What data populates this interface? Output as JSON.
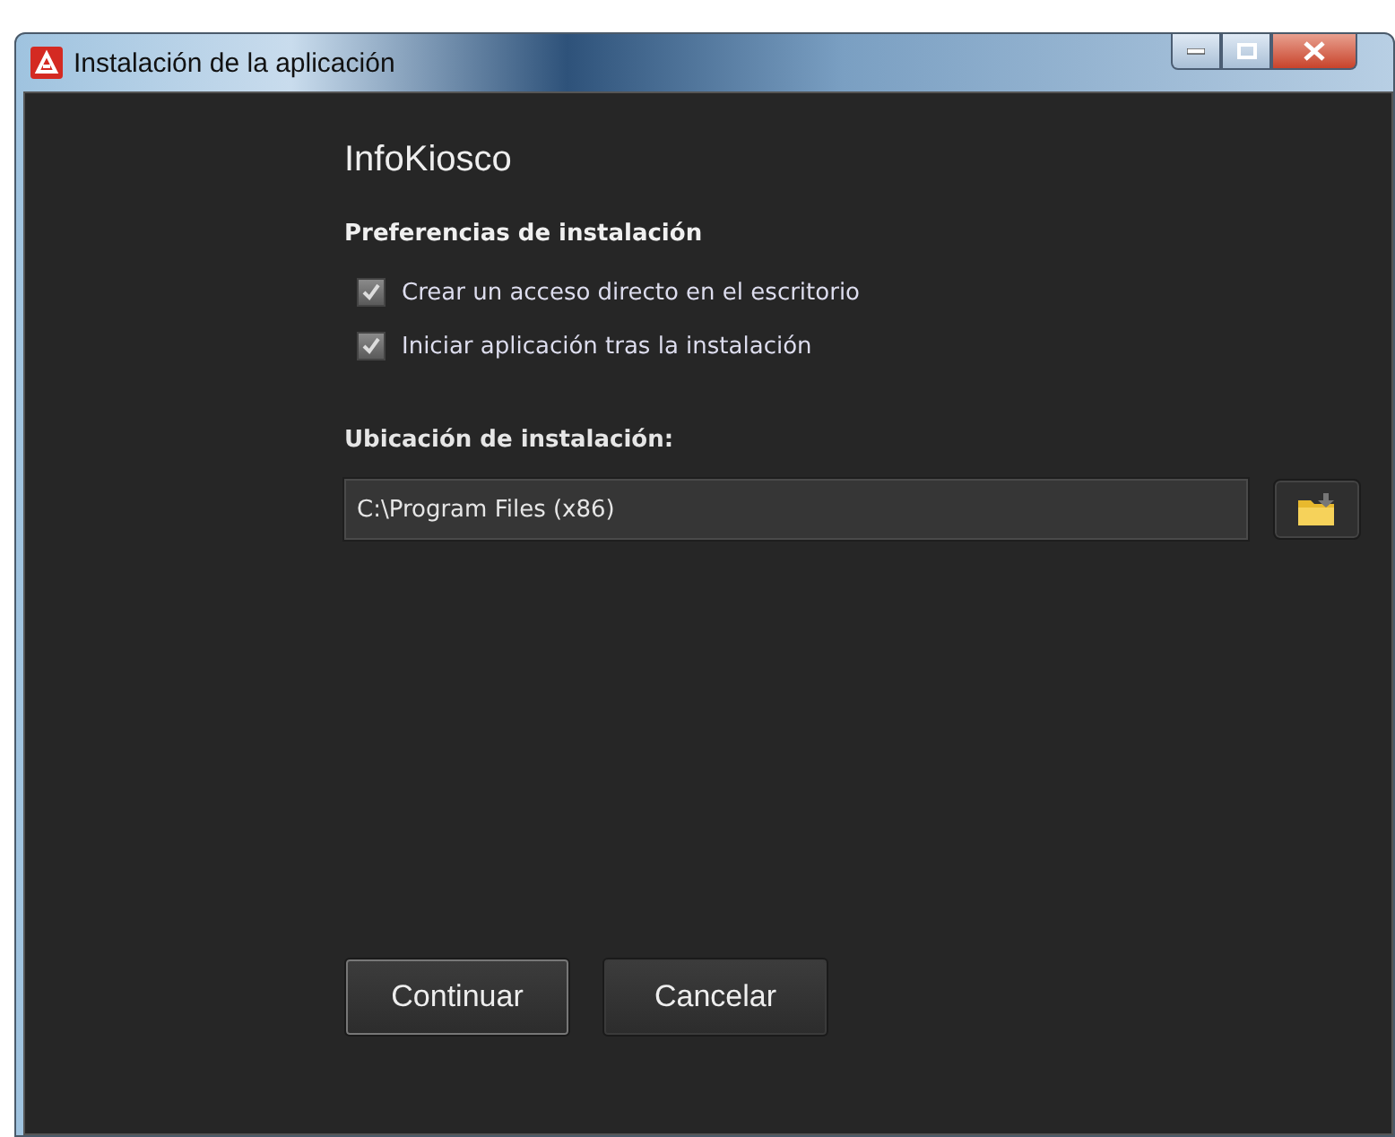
{
  "window": {
    "title": "Instalación de la aplicación"
  },
  "app_name": "InfoKiosco",
  "preferences": {
    "heading": "Preferencias de instalación",
    "options": [
      {
        "label": "Crear un acceso directo en el escritorio",
        "checked": true
      },
      {
        "label": "Iniciar aplicación tras la instalación",
        "checked": true
      }
    ]
  },
  "location": {
    "label": "Ubicación de instalación:",
    "value": "C:\\Program Files (x86)"
  },
  "buttons": [
    {
      "label": "Continuar",
      "selected": true
    },
    {
      "label": "Cancelar",
      "selected": false
    }
  ]
}
